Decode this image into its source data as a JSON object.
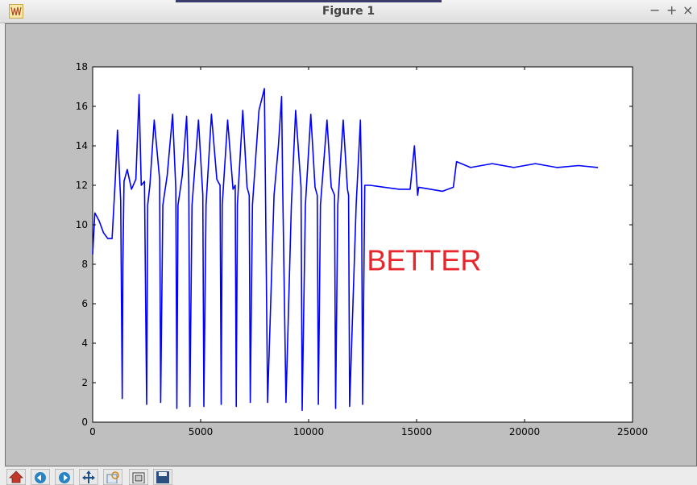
{
  "window": {
    "title": "Figure 1",
    "minimize_label": "−",
    "maximize_label": "+",
    "close_label": "×"
  },
  "toolbar": {
    "buttons": [
      "home-icon",
      "back-icon",
      "forward-icon",
      "pan-icon",
      "zoom-icon",
      "subplots-icon",
      "save-icon"
    ]
  },
  "chart_data": {
    "type": "line",
    "title": "",
    "xlabel": "",
    "ylabel": "",
    "xlim": [
      0,
      25000
    ],
    "ylim": [
      0,
      18
    ],
    "x_ticks": [
      0,
      5000,
      10000,
      15000,
      20000,
      25000
    ],
    "y_ticks": [
      0,
      2,
      4,
      6,
      8,
      10,
      12,
      14,
      16,
      18
    ],
    "grid": false,
    "legend": "none",
    "line_color": "#0000ff",
    "annotation": {
      "text": "BETTER",
      "x": 12700,
      "y": 7.7,
      "color": "#e8252b"
    },
    "series": [
      {
        "x": [
          0,
          100,
          300,
          500,
          700,
          900,
          1050,
          1150,
          1300,
          1370,
          1400,
          1450,
          1600,
          1800,
          2000,
          2150,
          2250,
          2400,
          2500,
          2550,
          2650,
          2850,
          3100,
          3150,
          3250,
          3450,
          3700,
          3850,
          3900,
          3950,
          4150,
          4350,
          4450,
          4500,
          4600,
          4900,
          5100,
          5150,
          5250,
          5500,
          5750,
          5900,
          5950,
          6000,
          6250,
          6500,
          6600,
          6650,
          6700,
          6950,
          7150,
          7250,
          7300,
          7400,
          7700,
          7950,
          8000,
          8100,
          8400,
          8600,
          8750,
          8800,
          8950,
          9200,
          9400,
          9650,
          9700,
          9850,
          10100,
          10300,
          10400,
          10450,
          10550,
          10850,
          11050,
          11200,
          11250,
          11350,
          11600,
          11800,
          11850,
          11900,
          12200,
          12400,
          12450,
          12500,
          12600,
          12850,
          13500,
          14200,
          14700,
          14900,
          15050,
          15100,
          16200,
          16700,
          16850,
          17500,
          18500,
          19500,
          20500,
          21500,
          22500,
          23400
        ],
        "y": [
          8.5,
          10.6,
          10.2,
          9.6,
          9.3,
          9.3,
          12.3,
          14.8,
          11.2,
          1.2,
          8,
          12.2,
          12.8,
          11.8,
          12.3,
          16.6,
          12,
          12.2,
          0.9,
          11,
          12,
          15.3,
          12.3,
          1,
          11,
          12.5,
          15.6,
          11.8,
          0.7,
          11,
          12.5,
          15.5,
          12,
          0.8,
          11,
          15.3,
          11.5,
          0.8,
          11,
          15.6,
          12.3,
          12,
          0.9,
          11,
          15.3,
          11.8,
          12,
          0.8,
          11,
          15.8,
          11.9,
          11.5,
          1,
          11,
          15.8,
          16.9,
          12,
          1,
          11.5,
          14,
          16.5,
          12,
          1,
          11,
          15.8,
          11.9,
          0.6,
          11,
          15.6,
          11.9,
          11.5,
          0.9,
          11,
          15.3,
          11.9,
          11.5,
          0.7,
          11,
          15.3,
          11.8,
          11.5,
          0.8,
          11,
          15.3,
          11.9,
          0.9,
          12,
          12,
          11.9,
          11.8,
          11.8,
          14,
          11.5,
          11.9,
          11.7,
          11.9,
          13.2,
          12.9,
          13.1,
          12.9,
          13.1,
          12.9,
          13,
          12.9
        ]
      }
    ]
  }
}
